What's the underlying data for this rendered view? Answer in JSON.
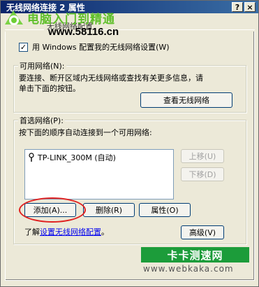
{
  "window": {
    "title": "无线网络连接 2 属性",
    "help_glyph": "?",
    "close_glyph": "×"
  },
  "watermark_top": {
    "cn_text": "电脑入门到精通",
    "url": "www.58116.cn"
  },
  "tabs": {
    "active_label": "无线网络配置"
  },
  "windows_config": {
    "checked": true,
    "label": "用 Windows 配置我的无线网络设置(W)"
  },
  "available_networks": {
    "title": "可用网络(N):",
    "line1": "要连接、断开区域内无线网络或查找有关更多信息，请",
    "line2": "单击下面的按钮。",
    "view_button": "查看无线网络"
  },
  "preferred_networks": {
    "title": "首选网络(P):",
    "desc": "按下面的顺序自动连接到一个可用网络:",
    "items": [
      {
        "label": "TP-LINK_300M (自动)"
      }
    ],
    "move_up": "上移(U)",
    "move_down": "下移(D)",
    "add": "添加(A)...",
    "remove": "删除(R)",
    "properties": "属性(O)",
    "learn_prefix": "了解",
    "learn_link": "设置无线网络配置",
    "learn_suffix": "。",
    "advanced": "高级(V)"
  },
  "watermark_bottom": {
    "name": "卡卡测速网",
    "url": "www.webkaka.com"
  },
  "colors": {
    "highlight_ellipse": "#e02020",
    "link": "#0000ee",
    "dialog_bg": "#ece9d8"
  }
}
